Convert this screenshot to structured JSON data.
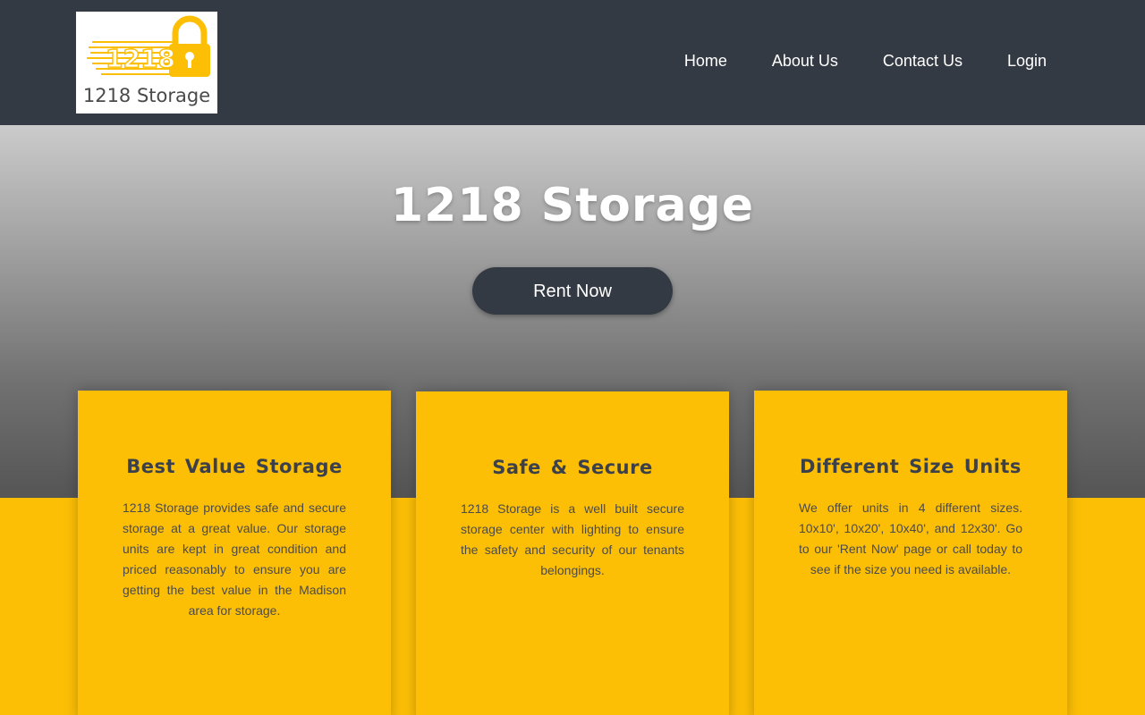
{
  "header": {
    "logo": {
      "number": "1218",
      "text": "1218 Storage",
      "icon": "padlock-icon",
      "accent": "#fdbf06"
    },
    "nav": [
      {
        "label": "Home"
      },
      {
        "label": "About Us"
      },
      {
        "label": "Contact Us"
      },
      {
        "label": "Login"
      }
    ],
    "background": "#343a43"
  },
  "hero": {
    "title": "1218 Storage",
    "cta_label": "Rent Now"
  },
  "features": [
    {
      "title": "Best Value Storage",
      "body": "1218 Storage provides safe and secure storage at a great value. Our storage units are kept in great condition and priced reasonably to ensure you are getting the best value in the Madison area for storage."
    },
    {
      "title": "Safe & Secure",
      "body": "1218 Storage is a well built secure storage center with lighting to ensure the safety and security of our tenants belongings."
    },
    {
      "title": "Different Size Units",
      "body": "We offer units in 4 different sizes. 10x10', 10x20', 10x40', and 12x30'. Go to our 'Rent Now' page or call today to see if the size you need is available."
    }
  ],
  "colors": {
    "accent": "#fdbf06",
    "dark": "#343a43"
  }
}
